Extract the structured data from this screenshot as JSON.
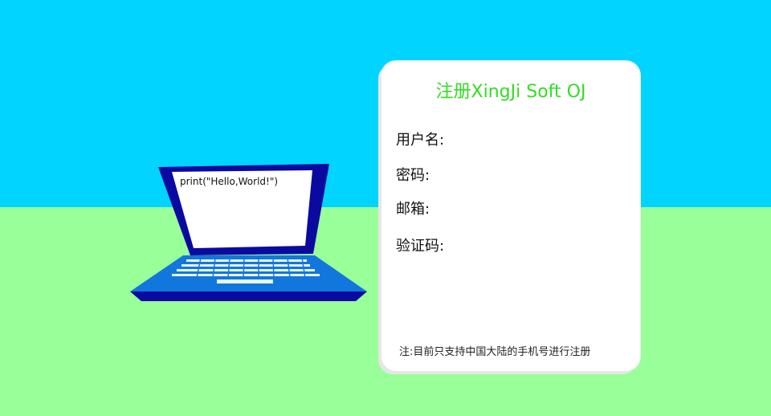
{
  "laptop": {
    "screen_text": "print(\"Hello,World!\")"
  },
  "register_card": {
    "title": "注册XingJi Soft OJ",
    "fields": [
      {
        "label": "用户名:"
      },
      {
        "label": "密码:"
      },
      {
        "label": "邮箱:"
      },
      {
        "label": "验证码:"
      }
    ],
    "note": "注:目前只支持中国大陆的手机号进行注册"
  },
  "colors": {
    "sky": "#00d4ff",
    "grass": "#99ff99",
    "title": "#33dd22",
    "laptop_frame": "#0a0aa0",
    "laptop_base": "#1177dd"
  }
}
